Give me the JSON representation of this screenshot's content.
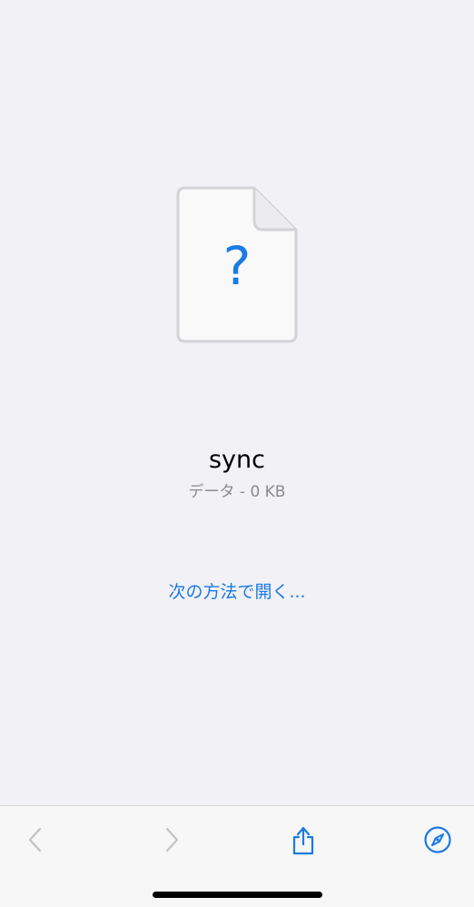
{
  "file": {
    "name": "sync",
    "meta": "データ - 0 KB",
    "icon": "unknown-file-icon",
    "glyph": "?"
  },
  "actions": {
    "open_with_label": "次の方法で開く..."
  },
  "toolbar": {
    "back_icon": "chevron-left-icon",
    "forward_icon": "chevron-right-icon",
    "share_icon": "share-icon",
    "safari_icon": "compass-icon"
  },
  "colors": {
    "background": "#f2f1f6",
    "accent": "#1a7ae6",
    "disabled": "#c4c4c8",
    "secondary_text": "#8a8a8e"
  }
}
